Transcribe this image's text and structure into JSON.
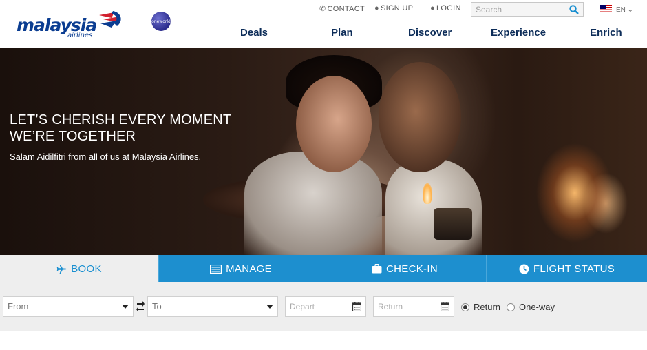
{
  "brand": {
    "name": "malaysia",
    "sub": "airlines",
    "alliance": "oneworld"
  },
  "top_links": {
    "contact": "CONTACT",
    "signup": "SIGN UP",
    "login": "LOGIN"
  },
  "search": {
    "placeholder": "Search"
  },
  "language": {
    "label": "EN",
    "flag": "malaysia-flag"
  },
  "nav": {
    "deals": "Deals",
    "plan": "Plan",
    "discover": "Discover",
    "experience": "Experience",
    "enrich": "Enrich"
  },
  "hero": {
    "title_line1": "LET’S CHERISH EVERY MOMENT",
    "title_line2": "WE’RE TOGETHER",
    "subtitle": "Salam Aidilfitri from all of us at Malaysia Airlines."
  },
  "tabs": {
    "book": "BOOK",
    "manage": "MANAGE",
    "checkin": "CHECK-IN",
    "flight_status": "FLIGHT STATUS",
    "active": "book"
  },
  "booking": {
    "from_placeholder": "From",
    "to_placeholder": "To",
    "depart_placeholder": "Depart",
    "return_placeholder": "Return",
    "trip_return": "Return",
    "trip_oneway": "One-way",
    "selected_trip": "Return"
  },
  "colors": {
    "brand_navy": "#0b3d91",
    "tab_blue": "#1d8fcf",
    "active_tab_text": "#1a8fd0",
    "form_bg": "#eeeeee"
  }
}
